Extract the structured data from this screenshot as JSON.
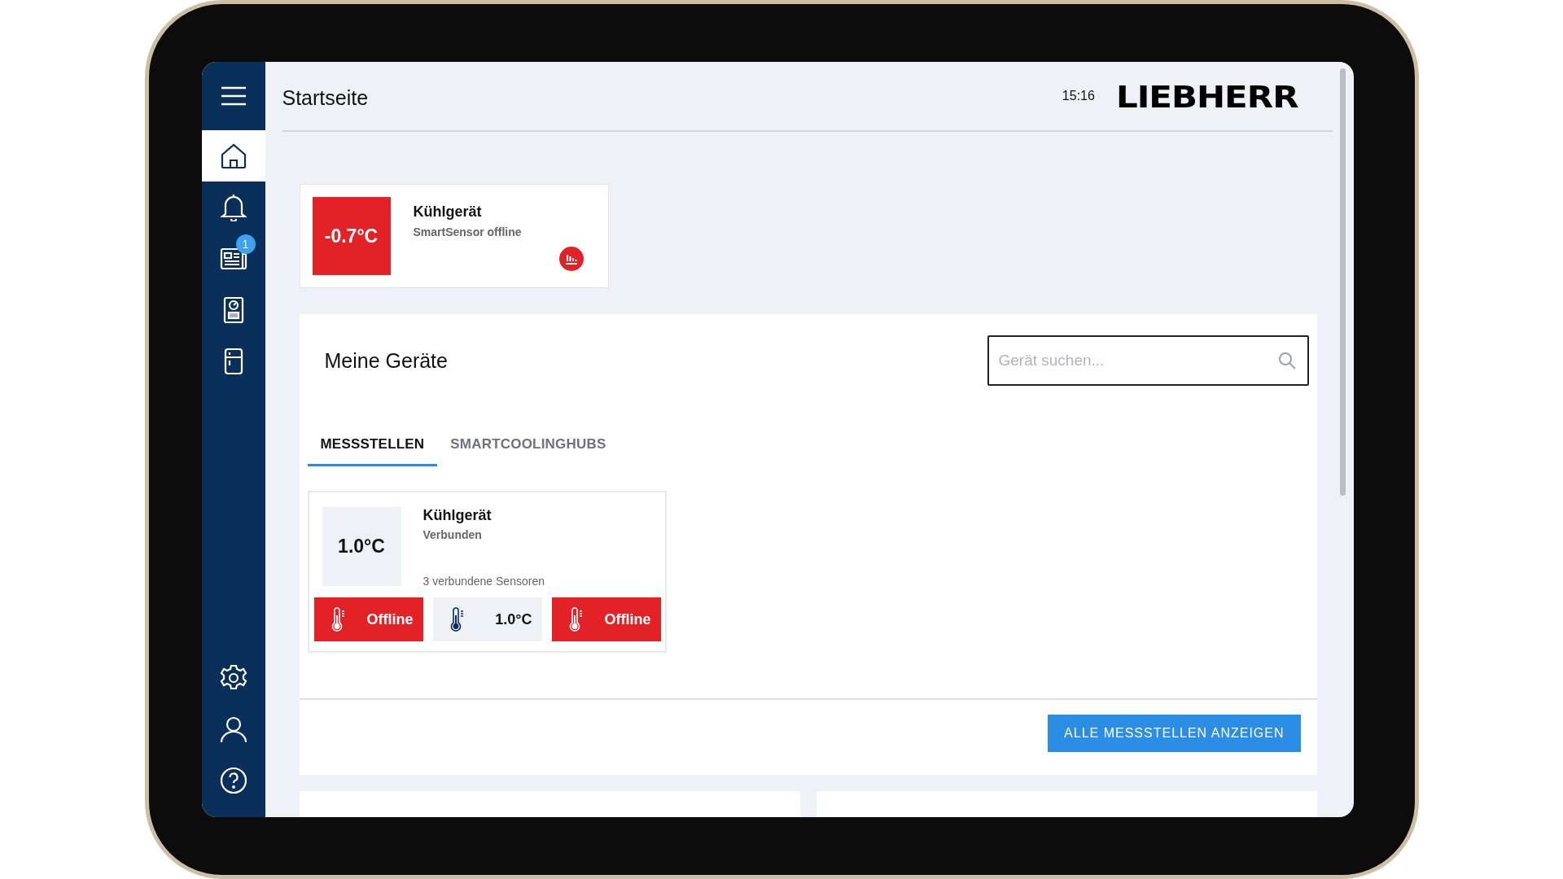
{
  "sidebar": {
    "top_items": [
      {
        "selected": true
      },
      {
        "selected": false
      },
      {
        "selected": false,
        "badge": "1"
      },
      {
        "selected": false
      },
      {
        "selected": false
      }
    ]
  },
  "header": {
    "title": "Startseite",
    "time": "15:16",
    "logo": "LIEBHERR"
  },
  "alert_card": {
    "temperature": "-0.7°C",
    "alarm": true,
    "name": "Kühlgerät",
    "status": "SmartSensor offline"
  },
  "devices": {
    "title": "Meine Geräte",
    "search": {
      "placeholder": "Gerät suchen..."
    },
    "tabs": [
      {
        "label": "MESSSTELLEN",
        "selected": true
      },
      {
        "label": "SMARTCOOLINGHUBS",
        "selected": false
      }
    ],
    "cards": [
      {
        "temperature": "1.0°C",
        "alarm": false,
        "name": "Kühlgerät",
        "status": "Verbunden",
        "sensor_count": "3 verbundene Sensoren",
        "sensors": [
          {
            "reading": "Offline",
            "alarm": true
          },
          {
            "reading": "1.0°C",
            "alarm": false
          },
          {
            "reading": "Offline",
            "alarm": true
          }
        ]
      }
    ],
    "button": "ALLE MESSSTELLEN ANZEIGEN"
  }
}
